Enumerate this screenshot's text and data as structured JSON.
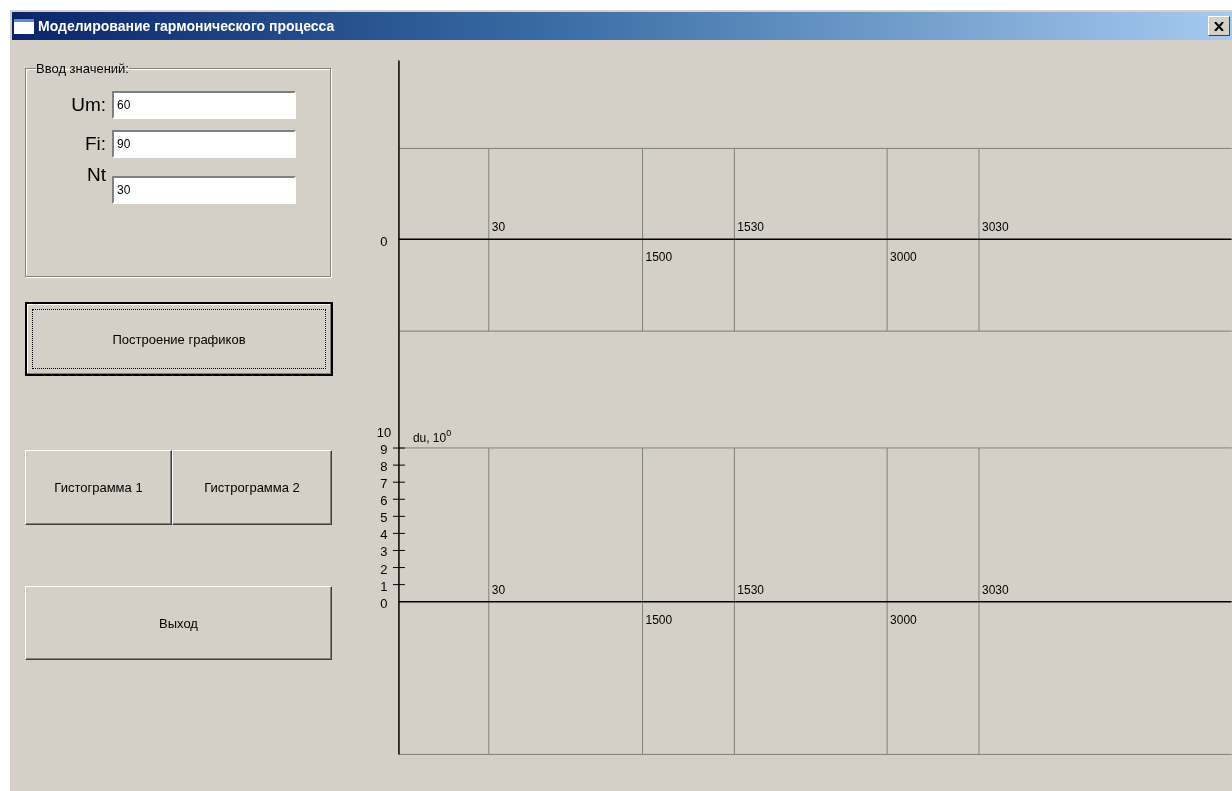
{
  "window": {
    "title": "Моделирование гармонического процесса"
  },
  "input_group": {
    "legend": "Ввод значений:",
    "fields": [
      {
        "label": "Um:",
        "value": "60"
      },
      {
        "label": "Fi:",
        "value": "90"
      },
      {
        "label": "Nt",
        "value": "30"
      }
    ]
  },
  "plot_button": {
    "label": "Построение графиков",
    "focused": true
  },
  "histogram_buttons": [
    {
      "label": "Гистограмма 1"
    },
    {
      "label": "Гистрограмма 2"
    }
  ],
  "exit_button": {
    "label": "Выход"
  },
  "plots": [
    {
      "y_labels": [
        "0"
      ],
      "x_labels": [
        "30",
        "1500",
        "1530",
        "3000",
        "3030"
      ]
    },
    {
      "y_title": "du, 10$^{0}$",
      "y_labels": [
        "10",
        "9",
        "8",
        "7",
        "6",
        "5",
        "4",
        "3",
        "2",
        "1",
        "0"
      ],
      "x_labels": [
        "30",
        "1500",
        "1530",
        "3000",
        "3030"
      ]
    }
  ]
}
